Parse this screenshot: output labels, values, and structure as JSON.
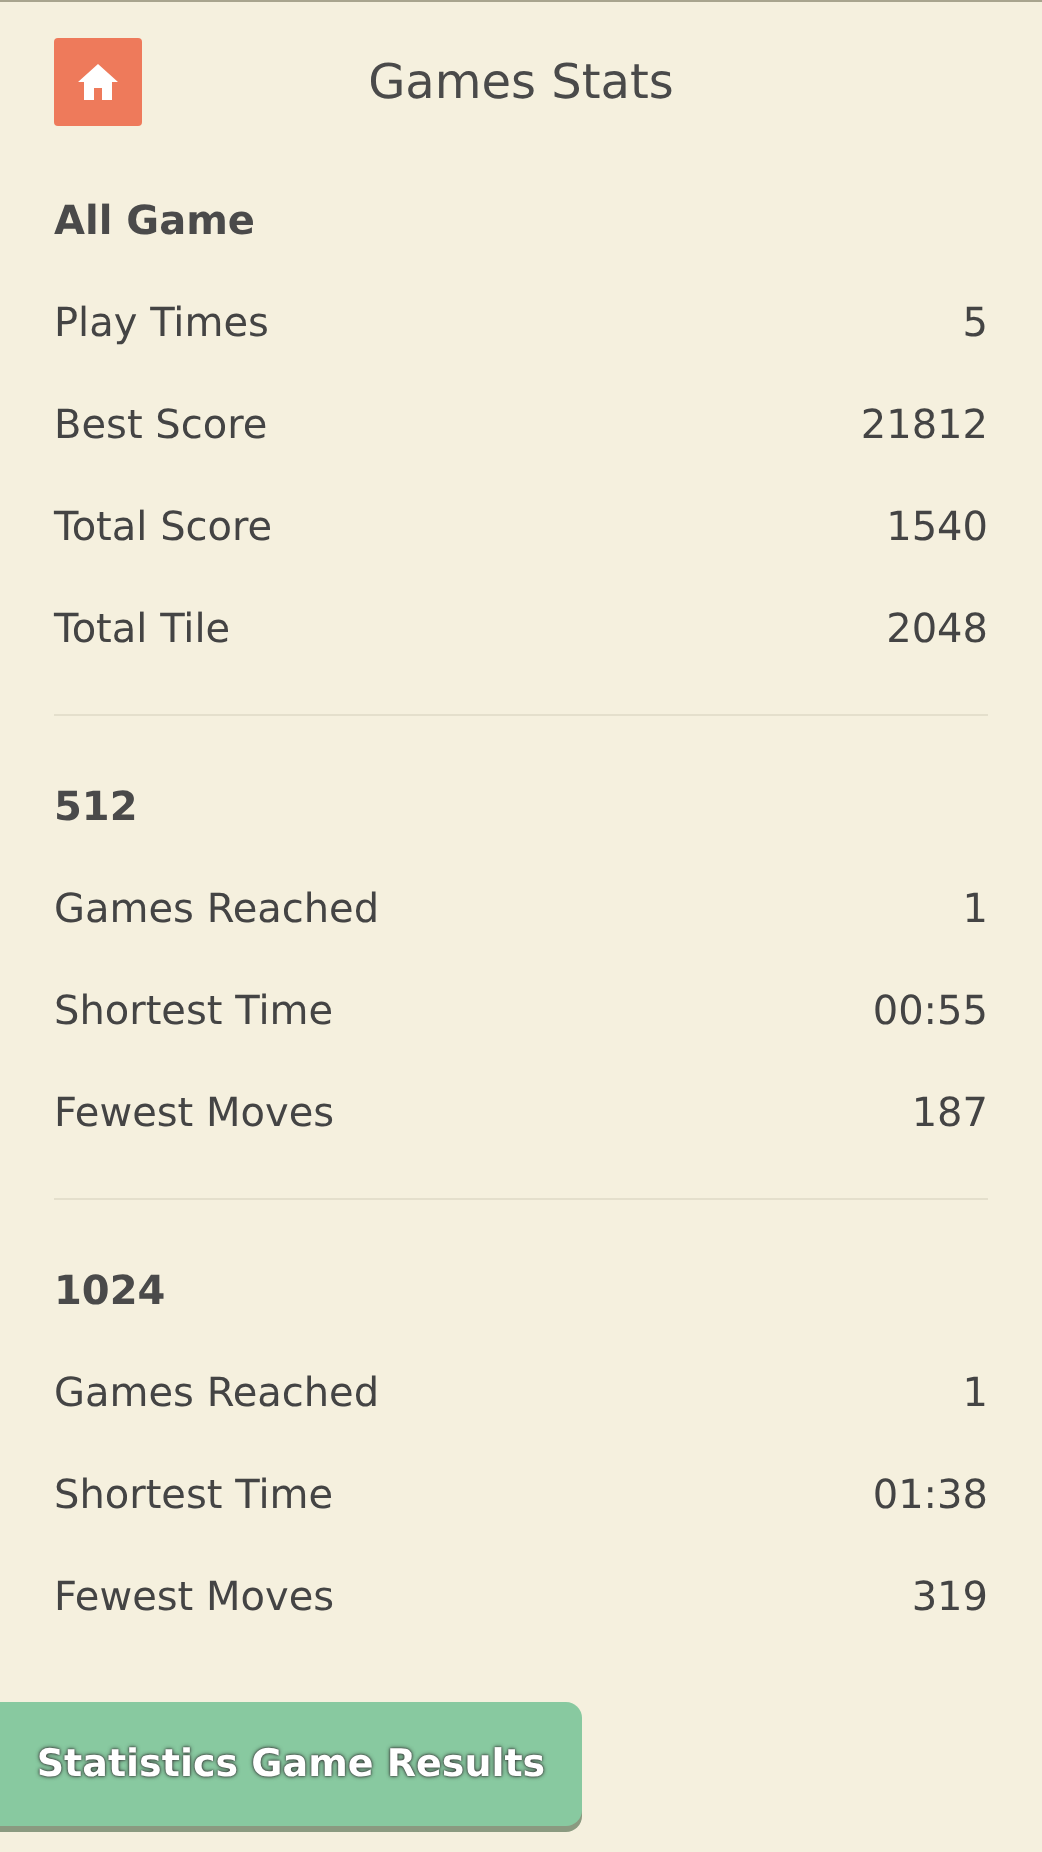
{
  "header": {
    "title": "Games Stats"
  },
  "sections": [
    {
      "heading": "All Game",
      "rows": [
        {
          "label": "Play Times",
          "value": "5"
        },
        {
          "label": "Best Score",
          "value": "21812"
        },
        {
          "label": "Total Score",
          "value": "1540"
        },
        {
          "label": "Total Tile",
          "value": "2048"
        }
      ]
    },
    {
      "heading": "512",
      "rows": [
        {
          "label": "Games Reached",
          "value": "1"
        },
        {
          "label": "Shortest Time",
          "value": "00:55"
        },
        {
          "label": "Fewest Moves",
          "value": "187"
        }
      ]
    },
    {
      "heading": "1024",
      "rows": [
        {
          "label": "Games Reached",
          "value": "1"
        },
        {
          "label": "Shortest Time",
          "value": "01:38"
        },
        {
          "label": "Fewest Moves",
          "value": "319"
        }
      ]
    }
  ],
  "results_button": {
    "label": "Statistics Game Results"
  }
}
